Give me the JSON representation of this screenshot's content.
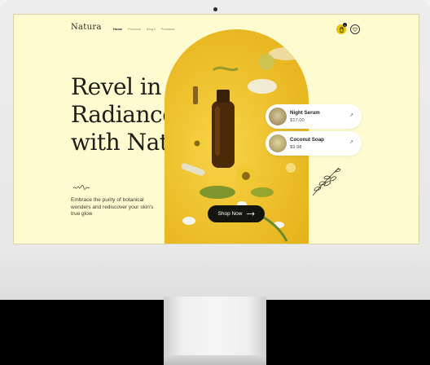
{
  "header": {
    "logo": "Natura",
    "nav": [
      {
        "label": "Home",
        "active": true
      },
      {
        "label": "Products",
        "active": false
      },
      {
        "label": "Blog",
        "active": false,
        "has_dropdown": true
      },
      {
        "label": "Purchase",
        "active": false
      }
    ],
    "cart_count": "1",
    "cart_icon": "shopping-bag-icon",
    "wishlist_icon": "heart-icon"
  },
  "hero": {
    "headline": [
      "Revel in",
      "Radiance",
      "with Natura"
    ],
    "description": "Embrace the purity of botanical wonders and rediscover your skin's true glow",
    "cta_label": "Shop Now",
    "cta_icon": "arrow-right-icon"
  },
  "products": [
    {
      "name": "Night Serum",
      "price": "$17.00"
    },
    {
      "name": "Coconut Soap",
      "price": "$9.98"
    }
  ],
  "colors": {
    "screen_bg": "#fffbd0",
    "accent": "#e8c100",
    "arch": "#eec12e",
    "button": "#15150f"
  }
}
